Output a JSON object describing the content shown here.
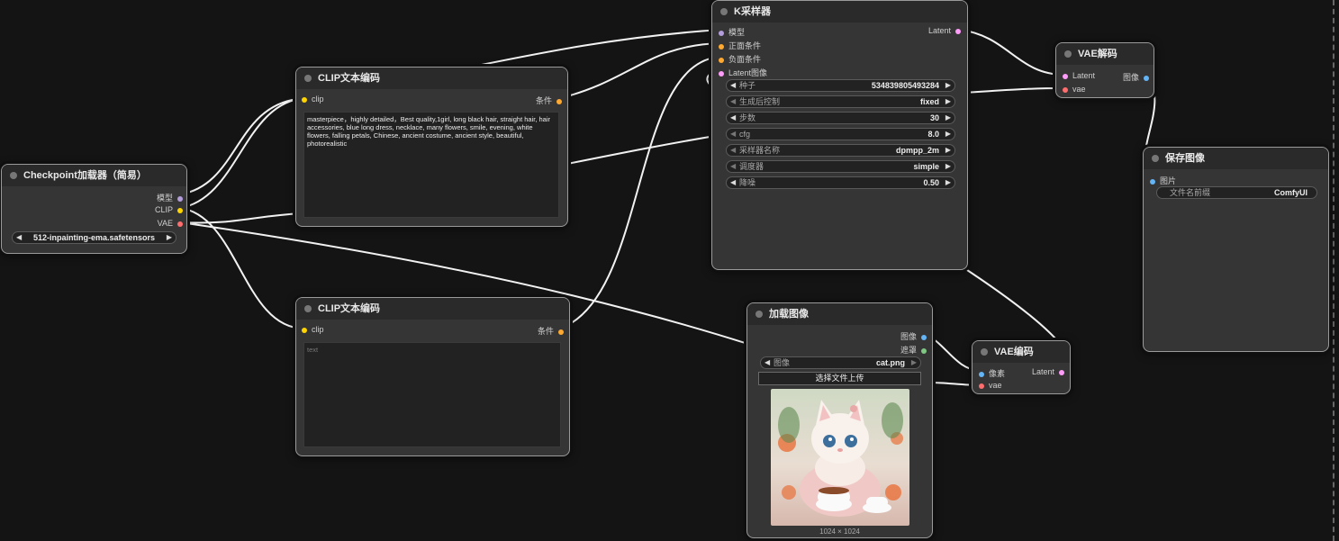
{
  "nodes": {
    "checkpoint": {
      "title": "Checkpoint加载器（简易）",
      "outputs": [
        "模型",
        "CLIP",
        "VAE"
      ],
      "ckpt_name": "512-inpainting-ema.safetensors"
    },
    "clip_pos": {
      "title": "CLIP文本编码",
      "input": "clip",
      "output": "条件",
      "text": "masterpiece，highly detailed，Best quality,1girl, long black hair, straight hair, hair accessories, blue long dress, necklace, many flowers, smile, evening, white flowers, falling petals, Chinese, ancient costume, ancient style, beautiful, photorealistic"
    },
    "clip_neg": {
      "title": "CLIP文本编码",
      "input": "clip",
      "output": "条件",
      "placeholder": "text"
    },
    "ksampler": {
      "title": "K采样器",
      "inputs": [
        "模型",
        "正面条件",
        "负面条件",
        "Latent图像"
      ],
      "output": "Latent",
      "widgets": [
        {
          "label": "种子",
          "value": "534839805493284"
        },
        {
          "label": "生成后控制",
          "value": "fixed"
        },
        {
          "label": "步数",
          "value": "30"
        },
        {
          "label": "cfg",
          "value": "8.0"
        },
        {
          "label": "采样器名称",
          "value": "dpmpp_2m"
        },
        {
          "label": "调度器",
          "value": "simple"
        },
        {
          "label": "降噪",
          "value": "0.50"
        }
      ]
    },
    "vae_decode": {
      "title": "VAE解码",
      "inputs": [
        "Latent",
        "vae"
      ],
      "output": "图像"
    },
    "save_image": {
      "title": "保存图像",
      "input": "图片",
      "widget_label": "文件名前缀",
      "widget_value": "ComfyUI"
    },
    "load_image": {
      "title": "加载图像",
      "outputs": [
        "图像",
        "遮罩"
      ],
      "widget_label": "图像",
      "widget_value": "cat.png",
      "upload_label": "选择文件上传",
      "dims": "1024 × 1024"
    },
    "vae_encode": {
      "title": "VAE编码",
      "inputs": [
        "像素",
        "vae"
      ],
      "output": "Latent"
    }
  },
  "icons": {
    "left_arrow": "◀",
    "right_arrow": "▶"
  },
  "colors": {
    "canvas": "#141414",
    "node_body": "#353535",
    "node_title": "#2a2a2a",
    "link": "#f2f2f2",
    "model": "#b39ddb",
    "clip": "#ffd500",
    "vae": "#ff6e6e",
    "conditioning": "#ffa931",
    "latent": "#ff9cf9",
    "image": "#64b5f6",
    "mask": "#81c784"
  }
}
